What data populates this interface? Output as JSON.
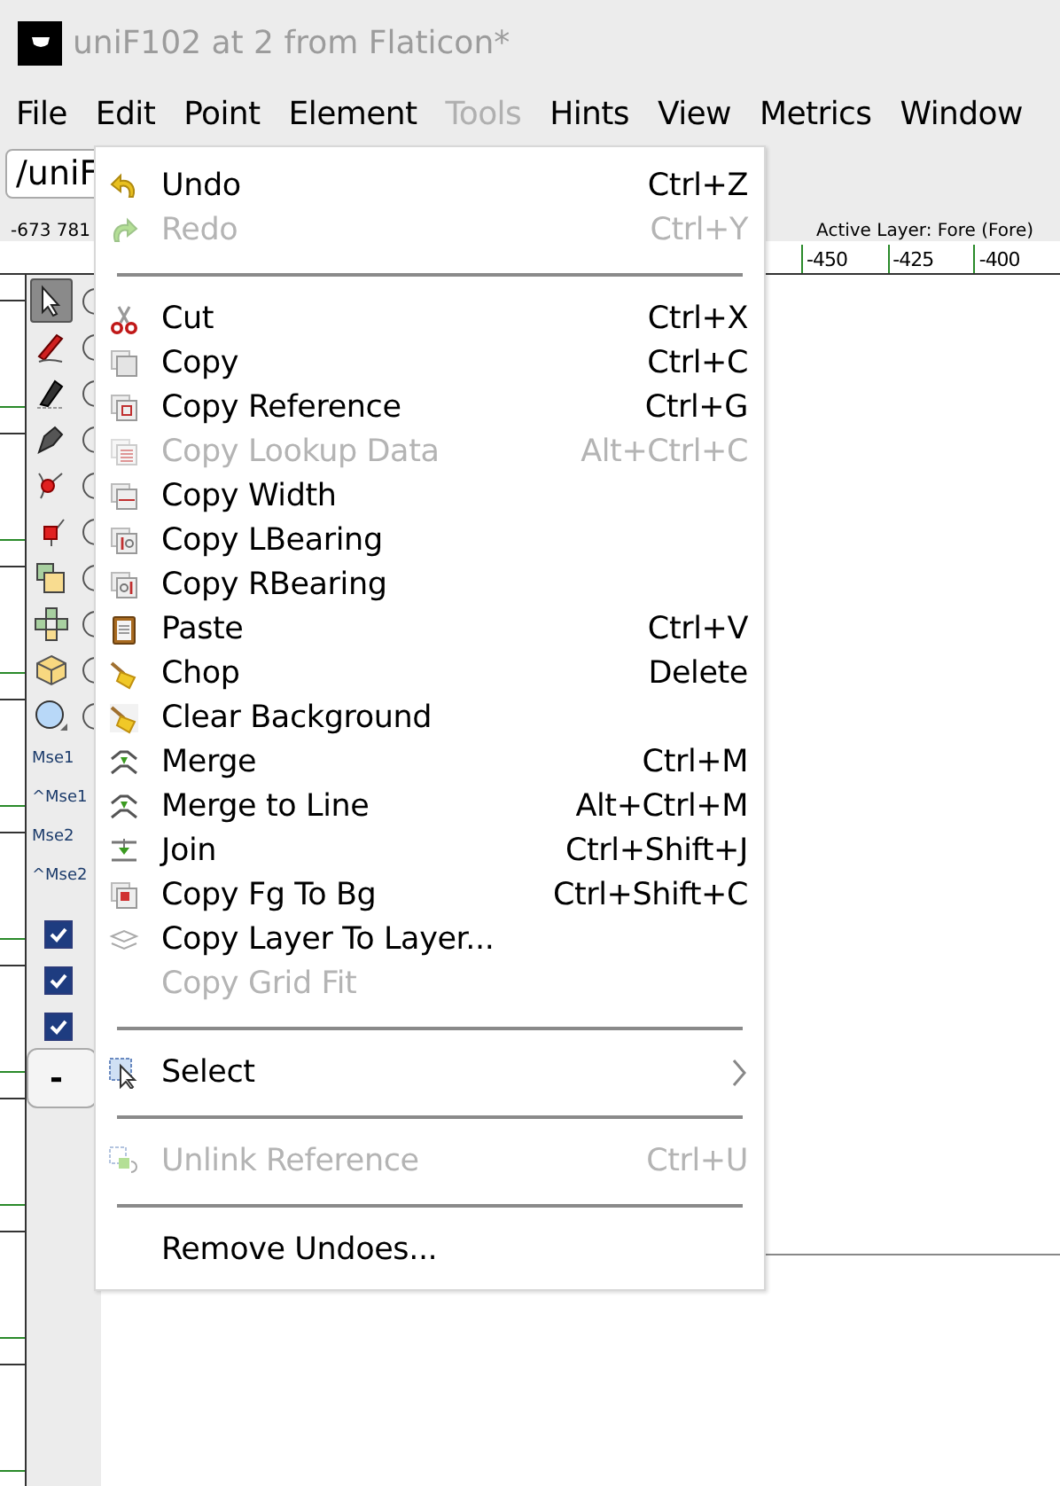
{
  "window": {
    "title": "uniF102 at 2 from Flaticon*"
  },
  "menubar": [
    {
      "label": "File",
      "disabled": false
    },
    {
      "label": "Edit",
      "disabled": false
    },
    {
      "label": "Point",
      "disabled": false
    },
    {
      "label": "Element",
      "disabled": false
    },
    {
      "label": "Tools",
      "disabled": true
    },
    {
      "label": "Hints",
      "disabled": false
    },
    {
      "label": "View",
      "disabled": false
    },
    {
      "label": "Metrics",
      "disabled": false
    },
    {
      "label": "Window",
      "disabled": false
    }
  ],
  "glyph_field": {
    "value": "/uniF"
  },
  "coordinates": "-673 781",
  "active_layer": "Active Layer: Fore (Fore)",
  "ruler": {
    "labels": [
      "-450",
      "-425",
      "-400"
    ]
  },
  "toolbox": {
    "tools": [
      {
        "selected": true
      },
      {
        "selected": false
      },
      {
        "selected": false
      },
      {
        "selected": false
      },
      {
        "selected": false
      },
      {
        "selected": false
      },
      {
        "selected": false
      },
      {
        "selected": false
      },
      {
        "selected": false
      },
      {
        "selected": false
      }
    ],
    "mouse_labels": [
      "Mse1",
      "^Mse1",
      "Mse2",
      "^Mse2"
    ]
  },
  "layers": {
    "checkboxes": [
      {
        "checked": true
      },
      {
        "checked": true
      },
      {
        "checked": true
      }
    ],
    "button": "-"
  },
  "edit_menu": [
    {
      "kind": "item",
      "label": "Undo",
      "shortcut": "Ctrl+Z",
      "disabled": false
    },
    {
      "kind": "item",
      "label": "Redo",
      "shortcut": "Ctrl+Y",
      "disabled": true
    },
    {
      "kind": "separator"
    },
    {
      "kind": "item",
      "label": "Cut",
      "shortcut": "Ctrl+X",
      "disabled": false
    },
    {
      "kind": "item",
      "label": "Copy",
      "shortcut": "Ctrl+C",
      "disabled": false
    },
    {
      "kind": "item",
      "label": "Copy Reference",
      "shortcut": "Ctrl+G",
      "disabled": false
    },
    {
      "kind": "item",
      "label": "Copy Lookup Data",
      "shortcut": "Alt+Ctrl+C",
      "disabled": true
    },
    {
      "kind": "item",
      "label": "Copy Width",
      "disabled": false
    },
    {
      "kind": "item",
      "label": "Copy LBearing",
      "disabled": false
    },
    {
      "kind": "item",
      "label": "Copy RBearing",
      "disabled": false
    },
    {
      "kind": "item",
      "label": "Paste",
      "shortcut": "Ctrl+V",
      "disabled": false
    },
    {
      "kind": "item",
      "label": "Chop",
      "shortcut": "Delete",
      "disabled": false
    },
    {
      "kind": "item",
      "label": "Clear Background",
      "disabled": false
    },
    {
      "kind": "item",
      "label": "Merge",
      "shortcut": "Ctrl+M",
      "disabled": false
    },
    {
      "kind": "item",
      "label": "Merge to Line",
      "shortcut": "Alt+Ctrl+M",
      "disabled": false
    },
    {
      "kind": "item",
      "label": "Join",
      "shortcut": "Ctrl+Shift+J",
      "disabled": false
    },
    {
      "kind": "item",
      "label": "Copy Fg To Bg",
      "shortcut": "Ctrl+Shift+C",
      "disabled": false
    },
    {
      "kind": "item",
      "label": "Copy Layer To Layer...",
      "disabled": false
    },
    {
      "kind": "item",
      "label": "Copy Grid Fit",
      "disabled": true
    },
    {
      "kind": "separator"
    },
    {
      "kind": "submenu",
      "label": "Select",
      "disabled": false
    },
    {
      "kind": "separator"
    },
    {
      "kind": "item",
      "label": "Unlink Reference",
      "shortcut": "Ctrl+U",
      "disabled": true
    },
    {
      "kind": "separator"
    },
    {
      "kind": "item",
      "label": "Remove Undoes...",
      "disabled": false
    }
  ]
}
